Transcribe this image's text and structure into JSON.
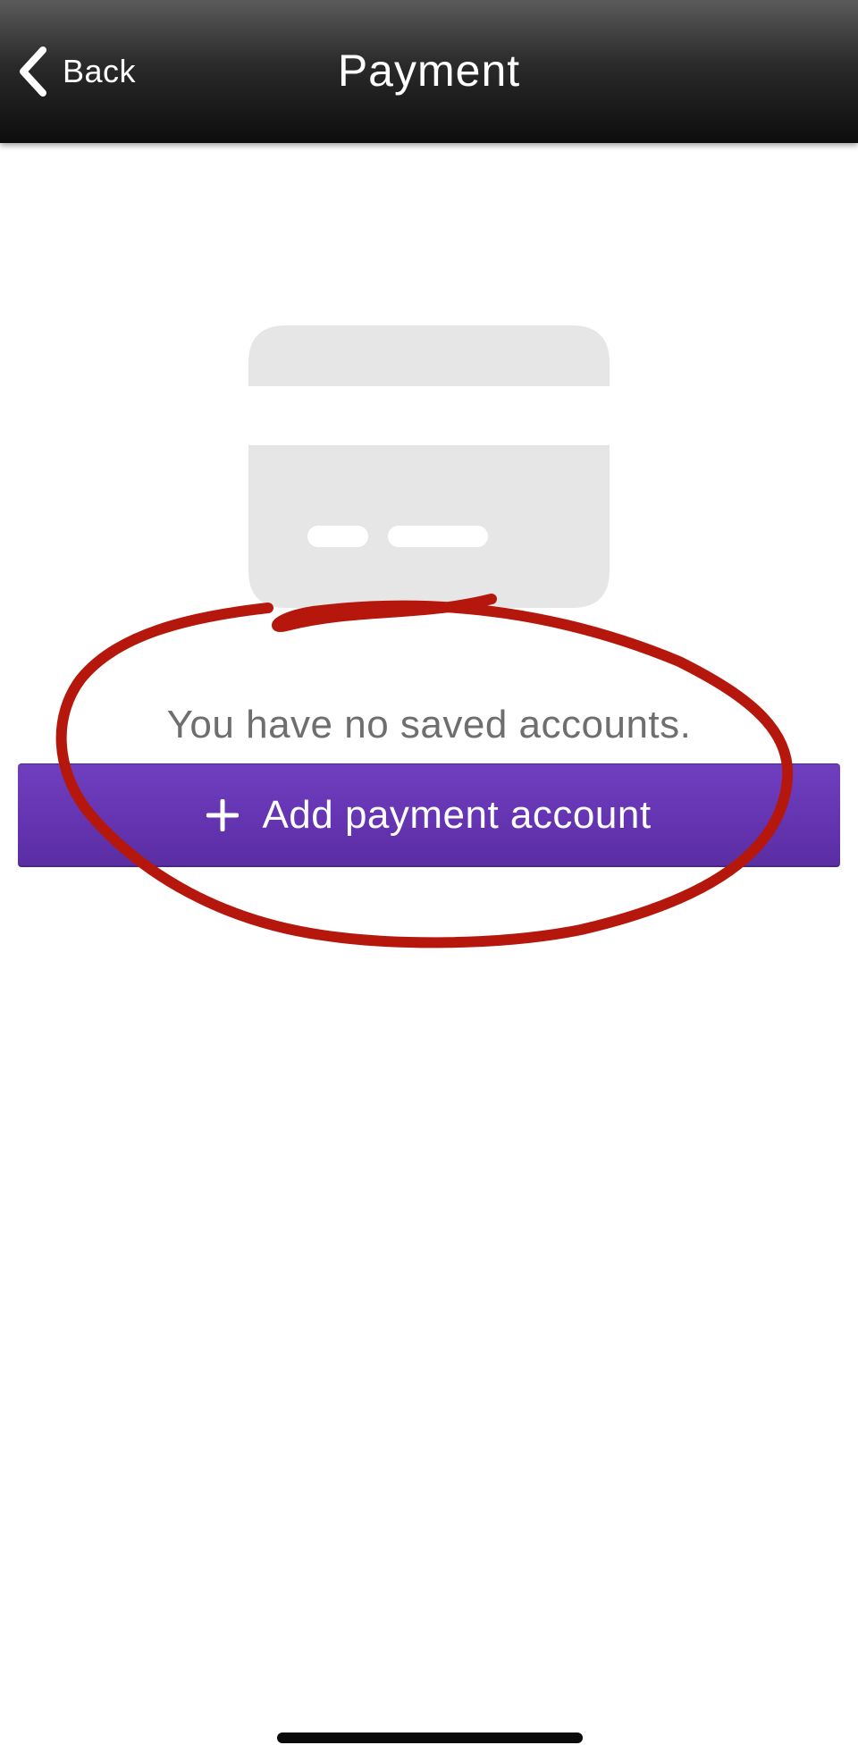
{
  "header": {
    "back_label": "Back",
    "title": "Payment"
  },
  "empty_state": {
    "message": "You have no saved accounts."
  },
  "add_button": {
    "label": "Add payment account"
  },
  "icons": {
    "back": "chevron-left-icon",
    "card": "credit-card-icon",
    "plus": "plus-icon"
  },
  "colors": {
    "navbar": "#1a1a1a",
    "button": "#6633b3",
    "annotation": "#b5170c",
    "card_placeholder": "#e6e6e6"
  }
}
